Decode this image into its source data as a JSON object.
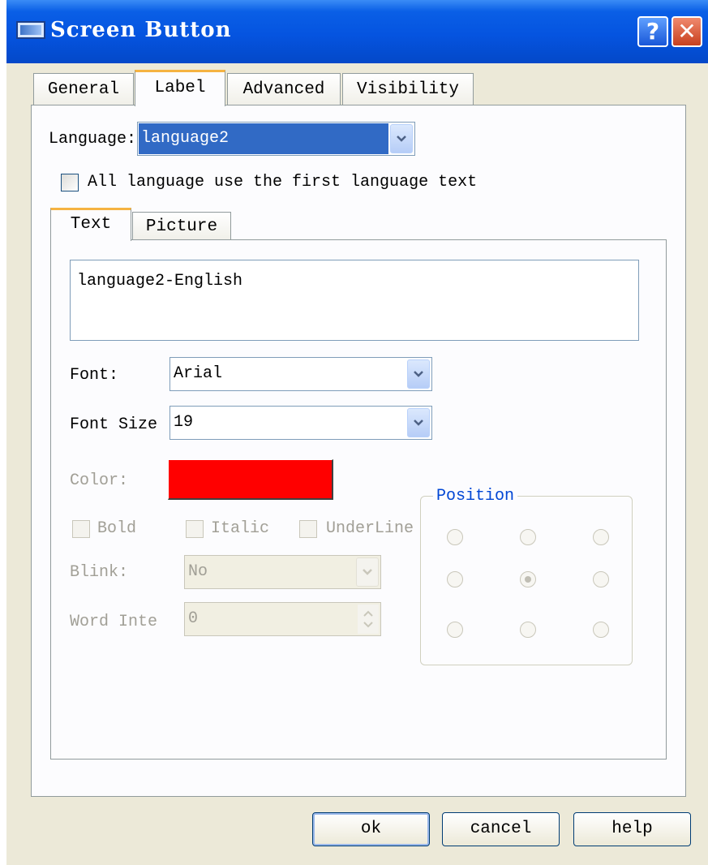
{
  "window": {
    "title": "Screen Button",
    "help_glyph": "?",
    "close_glyph": "✕"
  },
  "tabs": [
    {
      "label": "General"
    },
    {
      "label": "Label"
    },
    {
      "label": "Advanced"
    },
    {
      "label": "Visibility"
    }
  ],
  "active_tab": "Label",
  "language": {
    "label": "Language:",
    "value": "language2"
  },
  "all_language_checkbox": {
    "label": "All language use the first language text",
    "checked": false
  },
  "subtabs": [
    {
      "label": "Text"
    },
    {
      "label": "Picture"
    }
  ],
  "text_content": "language2-English",
  "font": {
    "label": "Font:",
    "value": "Arial"
  },
  "font_size": {
    "label": "Font Size",
    "value": "19"
  },
  "color": {
    "label": "Color:",
    "value": "#ff0000"
  },
  "style_options": [
    {
      "label": "Bold",
      "checked": false
    },
    {
      "label": "Italic",
      "checked": false
    },
    {
      "label": "UnderLine",
      "checked": false
    }
  ],
  "blink": {
    "label": "Blink:",
    "value": "No"
  },
  "word_interval": {
    "label": "Word Inte",
    "value": "0"
  },
  "position": {
    "label": "Position",
    "selected": "middle-center"
  },
  "buttons": {
    "ok": "ok",
    "cancel": "cancel",
    "help": "help"
  }
}
